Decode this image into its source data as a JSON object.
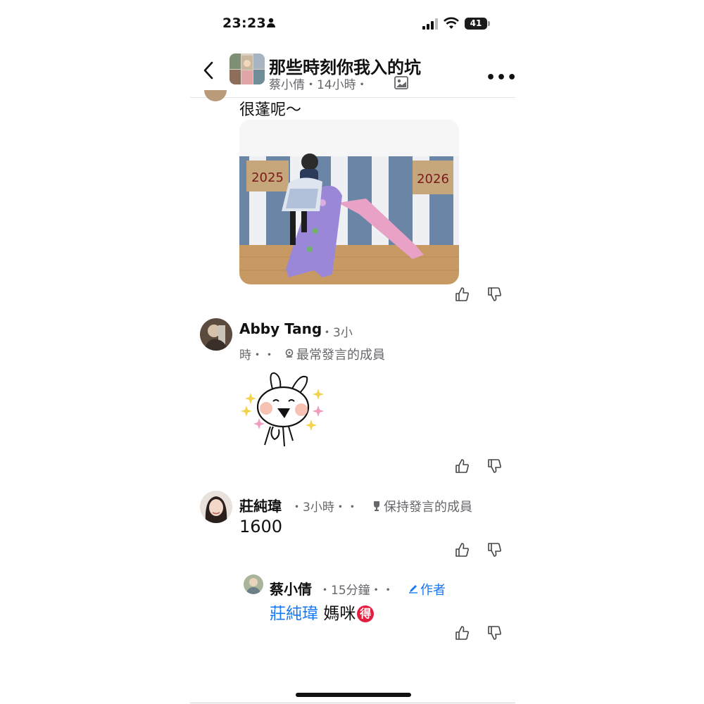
{
  "status_bar": {
    "time": "23:23",
    "battery": "41"
  },
  "header": {
    "group_name": "那些時刻你我入的坑",
    "subtitle": "蔡小倩・14小時・"
  },
  "post": {
    "text": "很蓬呢～"
  },
  "photo": {
    "sign_left": "2025",
    "sign_right": "2026"
  },
  "comments": [
    {
      "author": "Abby Tang",
      "meta_line1": "・3小",
      "meta_line2": "時・・",
      "badge": "最常發言的成員",
      "content_type": "sticker"
    },
    {
      "author": "莊純瑋",
      "meta": "・3小時・・",
      "badge": "保持發言的成員",
      "text": "1600"
    },
    {
      "author": "蔡小倩",
      "meta": "・15分鐘・・",
      "badge": "作者",
      "mention": "莊純瑋",
      "text": "媽咪",
      "emoji": "得"
    }
  ],
  "colors": {
    "accent": "#1877f2",
    "meta": "#65676b",
    "badge_red": "#e41e3f"
  }
}
